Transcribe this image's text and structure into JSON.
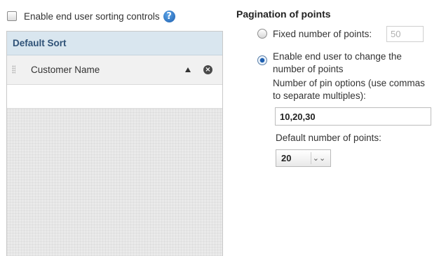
{
  "sorting": {
    "enable_label": "Enable end user sorting controls",
    "enable_checked": false,
    "help_icon": "question-circle-icon",
    "help_glyph": "?",
    "panel_title": "Default Sort",
    "items": [
      {
        "label": "Customer Name",
        "direction_icon": "sort-ascending-icon",
        "remove_icon": "remove-circle-icon",
        "remove_glyph": "×"
      }
    ]
  },
  "pagination": {
    "title": "Pagination of points",
    "fixed_option": {
      "label": "Fixed number of points:",
      "value": "50",
      "selected": false
    },
    "change_option": {
      "label_line1": "Enable end user to change the",
      "label_line2": "number of points",
      "selected": true
    },
    "pin_options": {
      "label_line1": "Number of pin options (use commas",
      "label_line2": "to separate multiples):",
      "value": "10,20,30"
    },
    "default_points": {
      "label": "Default number of points:",
      "value": "20",
      "chevron_icon": "double-chevron-down-icon",
      "chevron_glyph": "⌄⌄"
    }
  }
}
